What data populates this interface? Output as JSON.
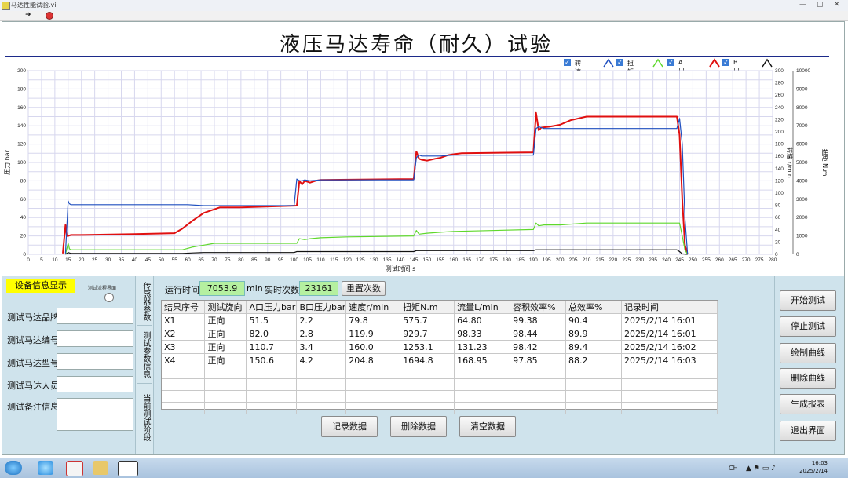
{
  "window": {
    "title": "马达性能试验.vi"
  },
  "page_title": "液压马达寿命（耐久）试验",
  "legend": [
    {
      "label": "转速",
      "color": "#1f4fbf"
    },
    {
      "label": "扭矩",
      "color": "#1f4fbf"
    },
    {
      "label": "A口压力",
      "color": "#5fd82c"
    },
    {
      "label": "B口压力",
      "color": "#e01010"
    }
  ],
  "chart_data": {
    "type": "line",
    "xlabel": "测试时间 s",
    "ylabel_left": "压力 bar",
    "ylabel_right1": "转速 r/min",
    "ylabel_right2": "扭矩 N.m",
    "x_range": [
      0,
      280
    ],
    "x_ticks": [
      0,
      5,
      10,
      15,
      20,
      25,
      30,
      35,
      40,
      45,
      50,
      55,
      60,
      65,
      70,
      75,
      80,
      85,
      90,
      95,
      100,
      105,
      110,
      115,
      120,
      125,
      130,
      135,
      140,
      145,
      150,
      155,
      160,
      165,
      170,
      175,
      180,
      185,
      190,
      195,
      200,
      205,
      210,
      215,
      220,
      225,
      230,
      235,
      240,
      245,
      250,
      255,
      260,
      265,
      270,
      275,
      280
    ],
    "y_left_range": [
      0,
      200
    ],
    "y_left_ticks": [
      0,
      20,
      40,
      60,
      80,
      100,
      120,
      140,
      160,
      180,
      200
    ],
    "y_right1_range": [
      0,
      300
    ],
    "y_right1_ticks": [
      0,
      20,
      40,
      60,
      80,
      100,
      120,
      140,
      160,
      180,
      200,
      220,
      240,
      260,
      280,
      300
    ],
    "y_right2_range": [
      0,
      10000
    ],
    "y_right2_ticks": [
      0,
      1000,
      2000,
      3000,
      4000,
      5000,
      6000,
      7000,
      8000,
      9000,
      10000
    ],
    "grid": true,
    "series": [
      {
        "name": "B口压力",
        "color": "#e01010",
        "width": 2,
        "x": [
          13,
          14,
          14.5,
          15,
          16,
          20,
          40,
          55,
          58,
          62,
          66,
          70,
          72,
          80,
          101,
          102,
          103,
          104,
          106,
          108,
          110,
          145,
          146,
          147,
          148,
          150,
          153,
          155,
          158,
          160,
          163,
          190,
          191,
          192,
          193,
          196,
          200,
          204,
          210,
          220,
          244,
          245,
          246,
          247,
          248
        ],
        "y": [
          1,
          32,
          20,
          20,
          21,
          21,
          22,
          23,
          28,
          37,
          45,
          49,
          51,
          51,
          53,
          80,
          76,
          80,
          78,
          80,
          81,
          82,
          112,
          104,
          103,
          102,
          104,
          105,
          108,
          109,
          110,
          111,
          154,
          135,
          138,
          139,
          141,
          146,
          150,
          150,
          150,
          130,
          60,
          10,
          0
        ]
      },
      {
        "name": "转速",
        "color": "#1f4fbf",
        "width": 1.2,
        "x": [
          14,
          15,
          15.5,
          16,
          20,
          30,
          50,
          60,
          66,
          70,
          100,
          101,
          102,
          103,
          104,
          106,
          110,
          145,
          146,
          147,
          148,
          150,
          155,
          160,
          165,
          190,
          191,
          192,
          194,
          196,
          200,
          244,
          245,
          246,
          247,
          248
        ],
        "y": [
          1,
          58,
          55,
          54,
          54,
          54,
          54,
          54,
          53,
          53,
          53,
          82,
          80,
          80,
          81,
          80,
          81,
          81,
          105,
          108,
          107,
          107,
          107,
          108,
          108,
          108,
          137,
          139,
          137,
          137,
          137,
          137,
          148,
          120,
          40,
          0
        ]
      },
      {
        "name": "A口压力",
        "color": "#5fd82c",
        "width": 1.2,
        "x": [
          14,
          15,
          15.5,
          16,
          20,
          40,
          58,
          62,
          66,
          70,
          72,
          80,
          101,
          102,
          104,
          106,
          110,
          120,
          145,
          146,
          147,
          150,
          155,
          160,
          190,
          191,
          192,
          194,
          200,
          210,
          244,
          245,
          246,
          247,
          248
        ],
        "y": [
          0,
          12,
          6,
          5,
          5,
          5,
          5,
          8,
          10,
          12,
          12,
          12,
          12,
          17,
          16,
          17,
          18,
          19,
          20,
          26,
          22,
          23,
          24,
          25,
          27,
          34,
          31,
          32,
          32,
          34,
          34,
          34,
          20,
          5,
          0
        ]
      },
      {
        "name": "扭矩",
        "color": "#111111",
        "width": 1.2,
        "x": [
          14,
          15,
          16,
          20,
          58,
          62,
          66,
          70,
          100,
          101,
          104,
          110,
          145,
          146,
          150,
          190,
          191,
          195,
          244,
          245,
          246,
          248
        ],
        "y": [
          0,
          2,
          1,
          1,
          1,
          1.5,
          2,
          2,
          2,
          3,
          3,
          3,
          3,
          4,
          4,
          4,
          5,
          5,
          5,
          3,
          0.5,
          0
        ]
      }
    ]
  },
  "device_info": {
    "header": "设备信息显示",
    "proc_label": "测试流程界面",
    "fields": [
      {
        "label": "测试马达品牌",
        "value": ""
      },
      {
        "label": "测试马达编号",
        "value": ""
      },
      {
        "label": "测试马达型号",
        "value": ""
      },
      {
        "label": "测试马达人员",
        "value": ""
      },
      {
        "label": "测试备注信息",
        "value": ""
      }
    ]
  },
  "tabs": [
    "传感器参数",
    "测试参数信息",
    "当前测试阶段"
  ],
  "run": {
    "run_time_label": "运行时间",
    "run_time_value": "7053.9",
    "run_time_unit": "min",
    "count_label": "实时次数",
    "count_value": "23161",
    "reset_button": "重置次数"
  },
  "table": {
    "headers": [
      "结果序号",
      "测试旋向",
      "A口压力bar",
      "B口压力bar",
      "速度r/min",
      "扭矩N.m",
      "流量L/min",
      "容积效率%",
      "总效率%",
      "记录时间"
    ],
    "rows": [
      [
        "X1",
        "正向",
        "51.5",
        "2.2",
        "79.8",
        "575.7",
        "64.80",
        "99.38",
        "90.4",
        "2025/2/14 16:01"
      ],
      [
        "X2",
        "正向",
        "82.0",
        "2.8",
        "119.9",
        "929.7",
        "98.33",
        "98.44",
        "89.9",
        "2025/2/14 16:01"
      ],
      [
        "X3",
        "正向",
        "110.7",
        "3.4",
        "160.0",
        "1253.1",
        "131.23",
        "98.42",
        "89.4",
        "2025/2/14 16:02"
      ],
      [
        "X4",
        "正向",
        "150.6",
        "4.2",
        "204.8",
        "1694.8",
        "168.95",
        "97.85",
        "88.2",
        "2025/2/14 16:03"
      ]
    ]
  },
  "table_buttons": [
    "记录数据",
    "删除数据",
    "清空数据"
  ],
  "right_buttons": [
    "开始测试",
    "停止测试",
    "绘制曲线",
    "删除曲线",
    "生成报表",
    "退出界面"
  ],
  "taskbar": {
    "time": "16:03",
    "date": "2025/2/14",
    "tray_text": "CH"
  }
}
